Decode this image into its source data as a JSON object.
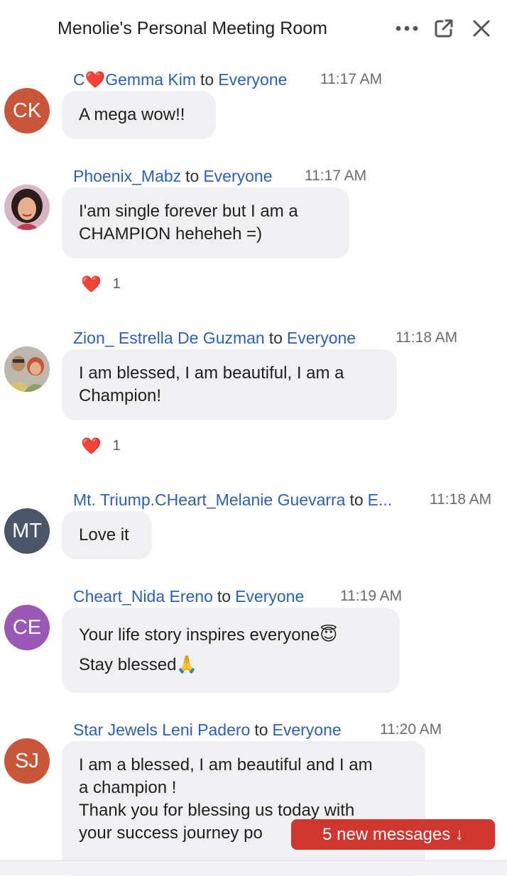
{
  "header": {
    "title": "Menolie's Personal Meeting Room"
  },
  "messages": [
    {
      "sender": "C❤️Gemma Kim",
      "to": "to",
      "recipient": "Everyone",
      "time": "11:17 AM",
      "avatar_initials": "CK",
      "avatar_color": "#c9553a",
      "lines": [
        "A mega wow!!"
      ]
    },
    {
      "sender": "Phoenix_Mabz",
      "to": "to",
      "recipient": "Everyone",
      "time": "11:17 AM",
      "avatar_photo": "portrait-photo",
      "lines": [
        "I'am single forever but I am a",
        "CHAMPION heheheh =)"
      ],
      "reaction": {
        "emoji": "❤️",
        "count": "1"
      }
    },
    {
      "sender": "Zion_ Estrella De Guzman",
      "to": "to",
      "recipient": "Everyone",
      "time": "11:18 AM",
      "avatar_photo": "couple-photo",
      "lines": [
        "I am blessed, I am beautiful, I am a",
        "Champion!"
      ],
      "reaction": {
        "emoji": "❤️",
        "count": "1"
      }
    },
    {
      "sender": "Mt. Triump.CHeart_Melanie Guevarra",
      "to": "to",
      "recipient": "E...",
      "time": "11:18 AM",
      "avatar_initials": "MT",
      "avatar_color": "#4a5568",
      "lines": [
        "Love it"
      ]
    },
    {
      "sender": "Cheart_Nida Ereno",
      "to": "to",
      "recipient": "Everyone",
      "time": "11:19 AM",
      "avatar_initials": "CE",
      "avatar_color": "#9b59b6",
      "lines": [
        "Your life story inspires everyone😇",
        "Stay blessed🙏"
      ]
    },
    {
      "sender": "Star Jewels Leni Padero",
      "to": "to",
      "recipient": "Everyone",
      "time": "11:20 AM",
      "avatar_initials": "SJ",
      "avatar_color": "#c9553a",
      "lines": [
        "I am a blessed, I am beautiful and I am",
        "a champion !",
        "Thank you for blessing us today with",
        "your success journey  po"
      ]
    }
  ],
  "new_messages": {
    "label": "5 new messages ↓"
  }
}
